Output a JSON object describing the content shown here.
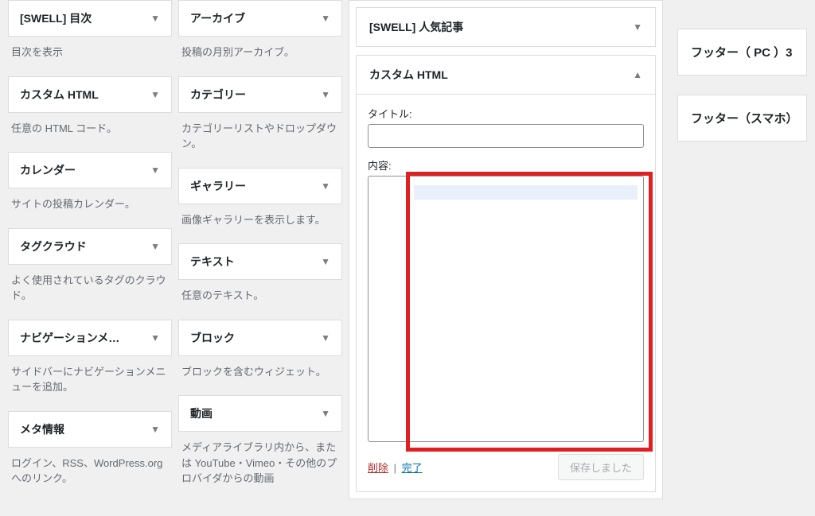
{
  "left_col": [
    {
      "title": "[SWELL] 目次",
      "desc": "目次を表示"
    },
    {
      "title": "カスタム HTML",
      "desc": "任意の HTML コード。"
    },
    {
      "title": "カレンダー",
      "desc": "サイトの投稿カレンダー。"
    },
    {
      "title": "タグクラウド",
      "desc": "よく使用されているタグのクラウド。"
    },
    {
      "title": "ナビゲーションメ…",
      "desc": "サイドバーにナビゲーションメニューを追加。"
    },
    {
      "title": "メタ情報",
      "desc": "ログイン、RSS、WordPress.org へのリンク。"
    }
  ],
  "mid_col": [
    {
      "title": "アーカイブ",
      "desc": "投稿の月別アーカイブ。"
    },
    {
      "title": "カテゴリー",
      "desc": "カテゴリーリストやドロップダウン。"
    },
    {
      "title": "ギャラリー",
      "desc": "画像ギャラリーを表示します。"
    },
    {
      "title": "テキスト",
      "desc": "任意のテキスト。"
    },
    {
      "title": "ブロック",
      "desc": "ブロックを含むウィジェット。"
    },
    {
      "title": "動画",
      "desc": "メディアライブラリ内から、または YouTube・Vimeo・その他のプロバイダからの動画"
    }
  ],
  "center": {
    "collapsed_title": "[SWELL] 人気記事",
    "open_title": "カスタム HTML",
    "title_label": "タイトル:",
    "content_label": "内容:",
    "title_value": "",
    "content_value": "",
    "delete_label": "削除",
    "done_label": "完了",
    "save_label": "保存しました"
  },
  "right_col": [
    "フッター（ PC ）3",
    "フッター（スマホ）"
  ]
}
